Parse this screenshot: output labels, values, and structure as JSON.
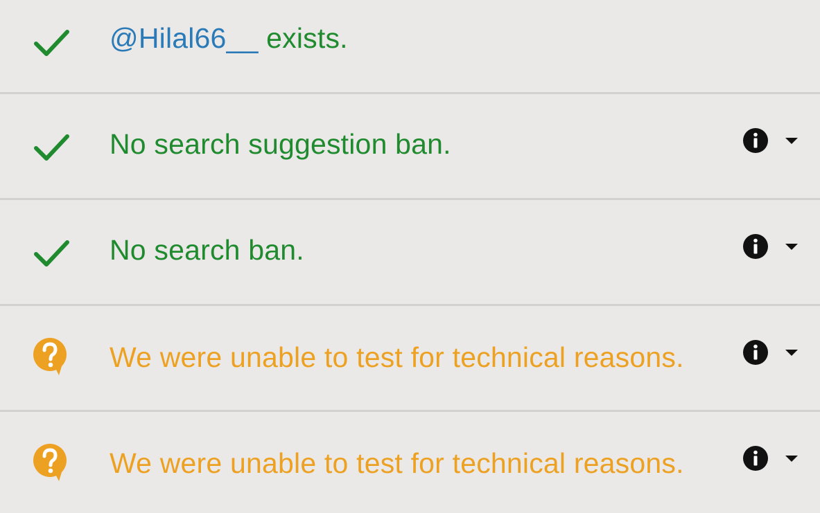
{
  "rows": [
    {
      "status": "ok",
      "handle": "@Hilal66__",
      "text": " exists."
    },
    {
      "status": "ok",
      "text": "No search suggestion ban."
    },
    {
      "status": "ok",
      "text": "No search ban."
    },
    {
      "status": "unknown",
      "text": "We were unable to test for technical reasons."
    },
    {
      "status": "unknown",
      "text": "We were unable to test for technical reasons."
    }
  ],
  "colors": {
    "ok": "#1f8a2e",
    "unknown": "#eda123",
    "handle": "#2a7ab8",
    "background": "#eae9e8",
    "divider": "#d3d1d0",
    "info_icon": "#111111"
  },
  "icons": {
    "ok": "check-icon",
    "unknown": "question-bubble-icon",
    "info": "info-icon",
    "expand": "caret-down-icon"
  }
}
